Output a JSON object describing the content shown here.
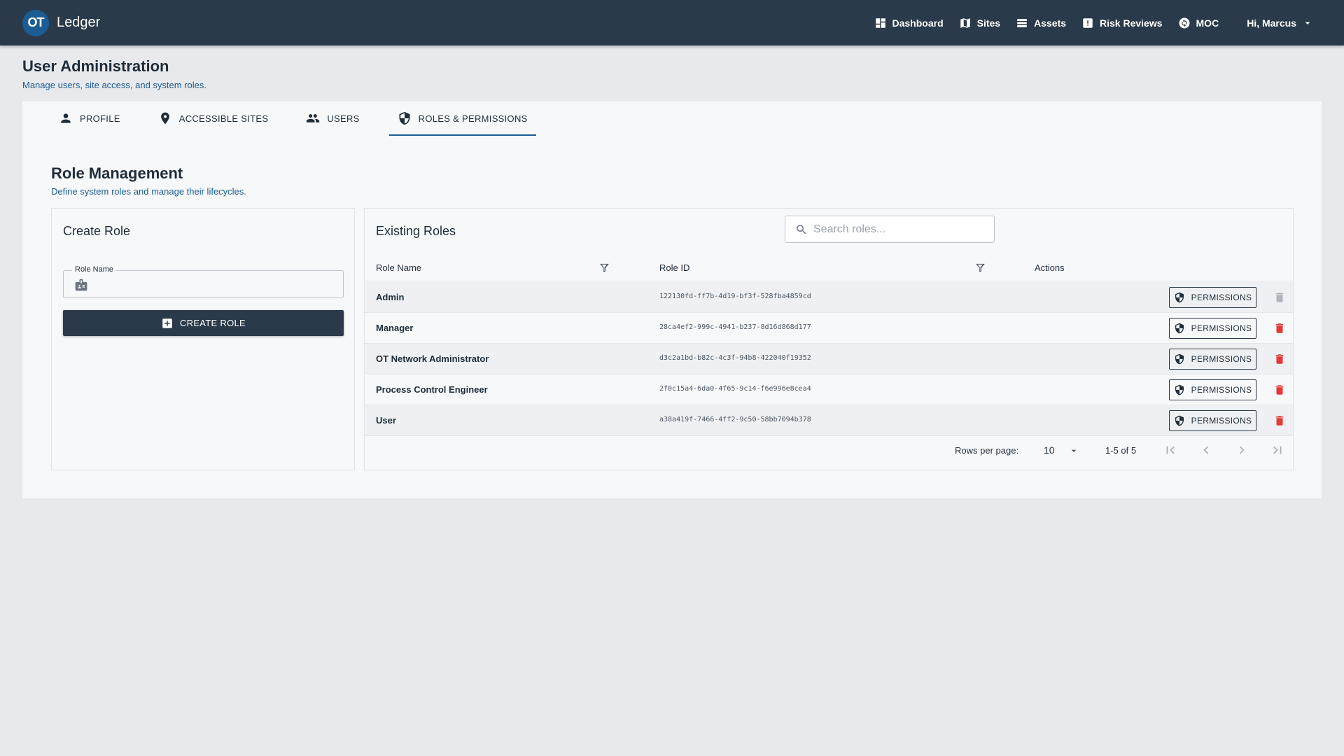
{
  "app": {
    "logo_text": "OT",
    "name": "Ledger"
  },
  "nav": {
    "dashboard": "Dashboard",
    "sites": "Sites",
    "assets": "Assets",
    "risk_reviews": "Risk Reviews",
    "moc": "MOC",
    "user_greeting": "Hi, Marcus"
  },
  "page": {
    "title": "User Administration",
    "subtitle": "Manage users, site access, and system roles."
  },
  "tabs": [
    {
      "label": "PROFILE",
      "icon": "person-icon"
    },
    {
      "label": "ACCESSIBLE SITES",
      "icon": "location-pin-icon"
    },
    {
      "label": "USERS",
      "icon": "group-icon"
    },
    {
      "label": "ROLES & PERMISSIONS",
      "icon": "shield-icon",
      "active": true
    }
  ],
  "section": {
    "title": "Role Management",
    "subtitle": "Define system roles and manage their lifecycles."
  },
  "create": {
    "title": "Create Role",
    "field_label": "Role Name",
    "field_value": "",
    "button_label": "CREATE ROLE"
  },
  "roles": {
    "title": "Existing Roles",
    "search_placeholder": "Search roles...",
    "col_name": "Role Name",
    "col_id": "Role ID",
    "col_actions": "Actions",
    "permissions_label": "PERMISSIONS",
    "rows": [
      {
        "name": "Admin",
        "id": "122130fd-ff7b-4d19-bf3f-528fba4859cd",
        "deletable": false
      },
      {
        "name": "Manager",
        "id": "28ca4ef2-999c-4941-b237-8d16d868d177",
        "deletable": true
      },
      {
        "name": "OT Network Administrator",
        "id": "d3c2a1bd-b82c-4c3f-94b8-422040f19352",
        "deletable": true
      },
      {
        "name": "Process Control Engineer",
        "id": "2f0c15a4-6da0-4f65-9c14-f6e996e8cea4",
        "deletable": true
      },
      {
        "name": "User",
        "id": "a38a419f-7466-4ff2-9c50-58bb7094b378",
        "deletable": true
      }
    ],
    "delete_color": "#e53935",
    "delete_disabled_color": "#b0b6bd"
  },
  "pagination": {
    "rows_per_page_label": "Rows per page:",
    "rows_per_page": "10",
    "range": "1-5 of 5"
  },
  "colors": {
    "topbar": "#2b3a4a",
    "accent": "#1b5c93"
  }
}
